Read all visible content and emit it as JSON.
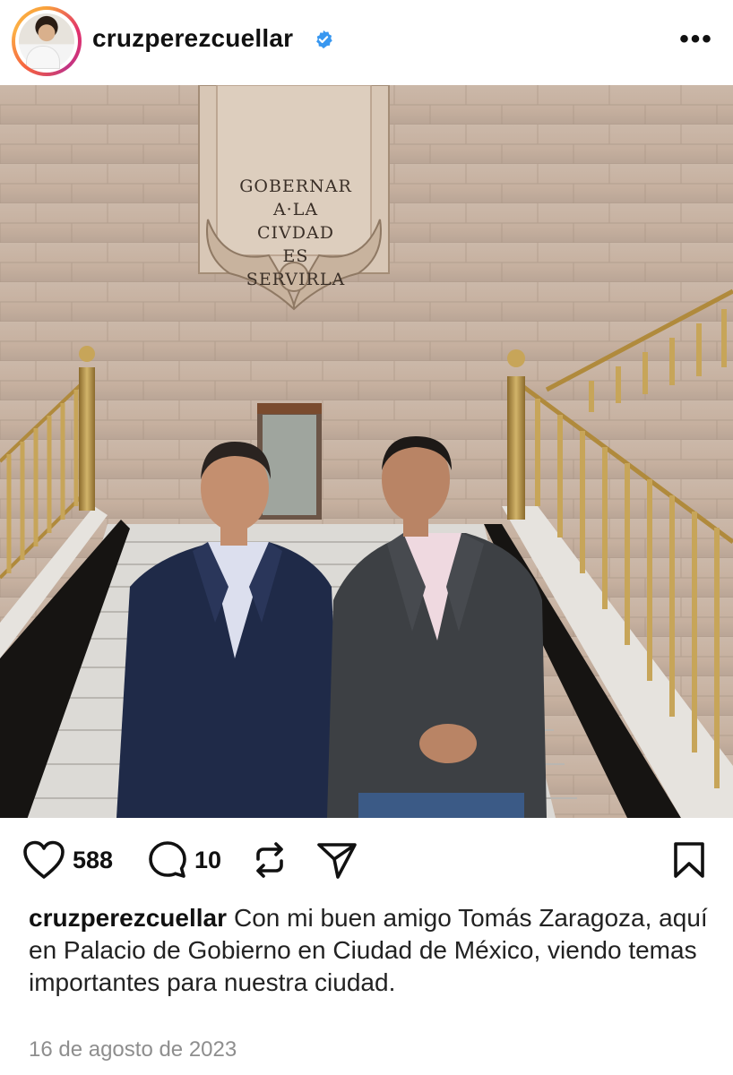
{
  "post": {
    "username": "cruzperezcuellar",
    "verified_icon": "verified-badge-icon",
    "more_icon": "more-options-icon",
    "image_plaque_lines": [
      "GOBERNAR",
      "A·LA",
      "CIVDAD",
      "ES",
      "SERVIRLA"
    ],
    "likes_count": "588",
    "comments_count": "10",
    "caption_username": "cruzperezcuellar",
    "caption_text": "Con mi buen amigo Tomás Zaragoza, aquí en Palacio de Gobierno en Ciudad de México, viendo temas importantes para nuestra ciudad.",
    "date": "16 de agosto de 2023",
    "icons": [
      "heart-icon",
      "comment-icon",
      "repost-icon",
      "share-icon",
      "bookmark-icon"
    ],
    "colors": {
      "verified": "#3897f0",
      "text": "#111111",
      "muted": "#8e8e8e"
    }
  }
}
